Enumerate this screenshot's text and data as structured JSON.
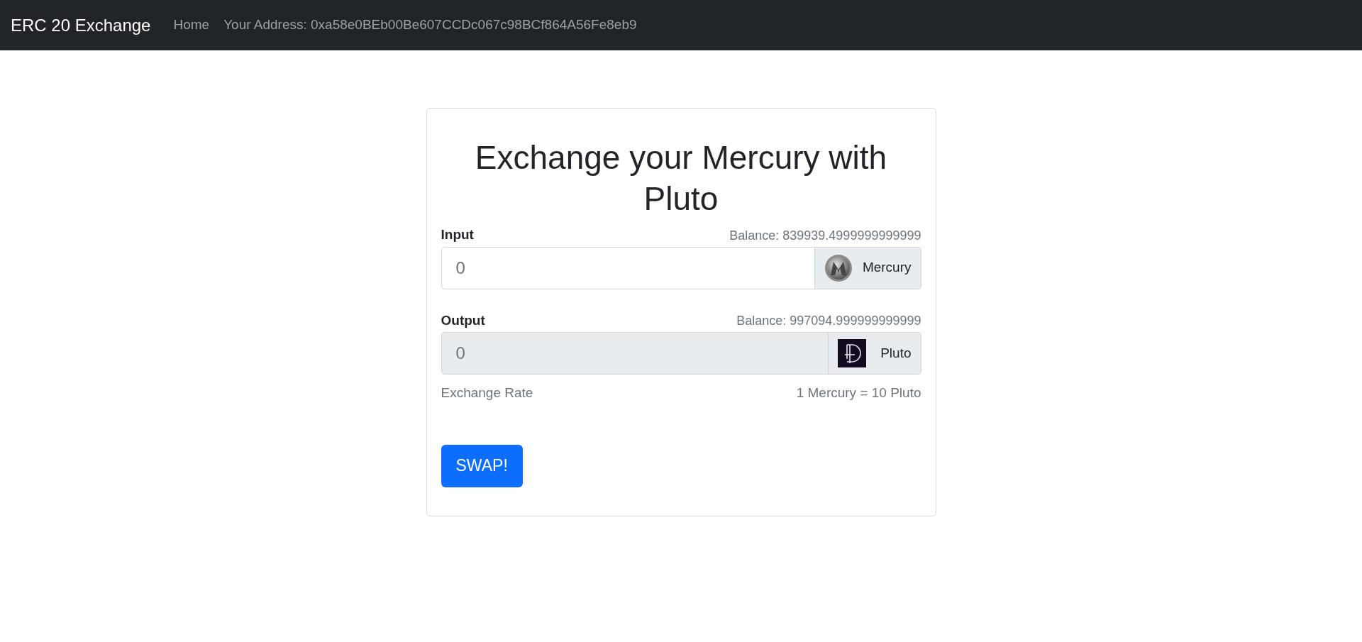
{
  "navbar": {
    "brand": "ERC 20 Exchange",
    "links": [
      {
        "label": "Home"
      },
      {
        "label": "Your Address: 0xa58e0BEb00Be607CCDc067c98BCf864A56Fe8eb9"
      }
    ]
  },
  "card": {
    "title": "Exchange your Mercury with Pluto",
    "fields": [
      {
        "label": "Input",
        "balance": "Balance: 839939.4999999999999",
        "placeholder": "0",
        "disabled": false,
        "token": "Mercury",
        "kind": "mercury"
      },
      {
        "label": "Output",
        "balance": "Balance: 997094.999999999999",
        "placeholder": "0",
        "disabled": true,
        "token": "Pluto",
        "kind": "pluto"
      }
    ],
    "rate_label": "Exchange Rate",
    "rate": "1 Mercury = 10 Pluto",
    "button": "SWAP!"
  }
}
